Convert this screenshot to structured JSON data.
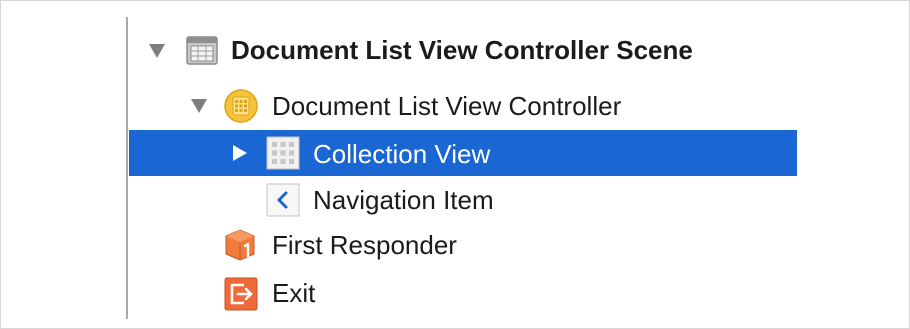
{
  "outline": {
    "scene": {
      "label": "Document List View Controller Scene",
      "icon": "storyboard-scene-icon",
      "expanded": true
    },
    "view_controller": {
      "label": "Document List View Controller",
      "icon": "view-controller-icon",
      "expanded": true
    },
    "collection_view": {
      "label": "Collection View",
      "icon": "collection-view-icon",
      "expanded": false,
      "selected": true
    },
    "navigation_item": {
      "label": "Navigation Item",
      "icon": "navigation-item-icon"
    },
    "first_responder": {
      "label": "First Responder",
      "icon": "first-responder-icon"
    },
    "exit": {
      "label": "Exit",
      "icon": "exit-icon"
    }
  },
  "colors": {
    "selection": "#1a66d3",
    "view_controller_icon": "#f5c23a",
    "first_responder_icon": "#f07b3c",
    "exit_icon": "#ef6a3b",
    "navigation_chevron": "#1a66d3"
  }
}
